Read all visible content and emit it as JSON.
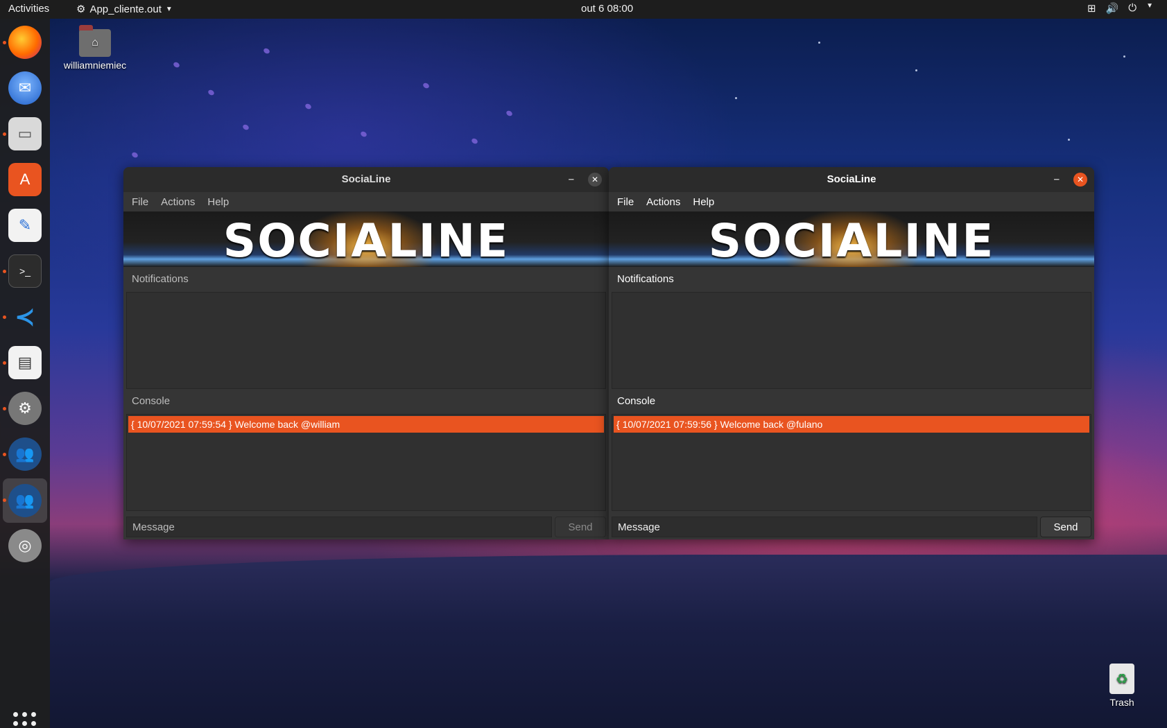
{
  "topbar": {
    "activities": "Activities",
    "app_name": "App_cliente.out",
    "clock": "out 6  08:00",
    "icons": [
      "network-icon",
      "volume-icon",
      "power-icon",
      "chevron-down-icon"
    ]
  },
  "dock": {
    "items": [
      "firefox-icon",
      "thunderbird-icon",
      "files-icon",
      "software-icon",
      "text-editor-icon",
      "terminal-icon",
      "vscode-icon",
      "document-viewer-icon",
      "settings-icon",
      "socialine-icon",
      "socialine-icon",
      "disc-icon"
    ],
    "show_apps": "apps-grid-icon"
  },
  "desktop": {
    "home_label": "williamniemiec",
    "trash_label": "Trash"
  },
  "windows": [
    {
      "title": "SociaLine",
      "menu": [
        "File",
        "Actions",
        "Help"
      ],
      "banner": "SOCIALINE",
      "notifications_label": "Notifications",
      "console_label": "Console",
      "console_lines": [
        "{ 10/07/2021 07:59:54 } Welcome back @william"
      ],
      "message_placeholder": "Message",
      "send_label": "Send"
    },
    {
      "title": "SociaLine",
      "menu": [
        "File",
        "Actions",
        "Help"
      ],
      "banner": "SOCIALINE",
      "notifications_label": "Notifications",
      "console_label": "Console",
      "console_lines": [
        "{ 10/07/2021 07:59:56 } Welcome back @fulano"
      ],
      "message_placeholder": "Message",
      "send_label": "Send"
    }
  ],
  "colors": {
    "accent": "#e95420",
    "window_bg": "#353535",
    "topbar_bg": "#1d1d1d"
  }
}
